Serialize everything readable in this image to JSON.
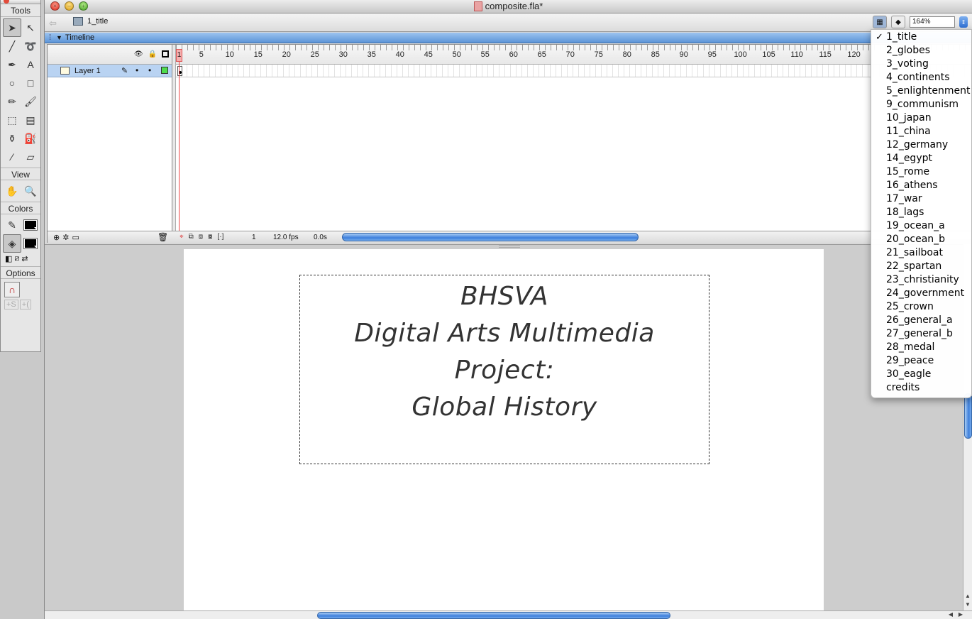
{
  "window": {
    "title": "composite.fla*"
  },
  "tools_panel": {
    "title": "Tools",
    "view_label": "View",
    "colors_label": "Colors",
    "options_label": "Options",
    "tools": [
      {
        "name": "selection-tool",
        "icon": "arrow-icon",
        "glyph": "➤"
      },
      {
        "name": "subselection-tool",
        "icon": "white-arrow-icon",
        "glyph": "↖"
      },
      {
        "name": "line-tool",
        "icon": "line-icon",
        "glyph": "╱"
      },
      {
        "name": "lasso-tool",
        "icon": "lasso-icon",
        "glyph": "➰"
      },
      {
        "name": "pen-tool",
        "icon": "pen-icon",
        "glyph": "✒"
      },
      {
        "name": "text-tool",
        "icon": "text-icon",
        "glyph": "A"
      },
      {
        "name": "oval-tool",
        "icon": "oval-icon",
        "glyph": "○"
      },
      {
        "name": "rectangle-tool",
        "icon": "rectangle-icon",
        "glyph": "□"
      },
      {
        "name": "pencil-tool",
        "icon": "pencil-icon",
        "glyph": "✏"
      },
      {
        "name": "brush-tool",
        "icon": "brush-icon",
        "glyph": "🖌"
      },
      {
        "name": "free-transform-tool",
        "icon": "free-transform-icon",
        "glyph": "⬚"
      },
      {
        "name": "gradient-transform-tool",
        "icon": "gradient-transform-icon",
        "glyph": "▤"
      },
      {
        "name": "ink-bottle-tool",
        "icon": "ink-bottle-icon",
        "glyph": "⚱"
      },
      {
        "name": "paint-bucket-tool",
        "icon": "paint-bucket-icon",
        "glyph": "⛽"
      },
      {
        "name": "eyedropper-tool",
        "icon": "eyedropper-icon",
        "glyph": "⁄"
      },
      {
        "name": "eraser-tool",
        "icon": "eraser-icon",
        "glyph": "▱"
      }
    ],
    "view_tools": [
      {
        "name": "hand-tool",
        "icon": "hand-icon",
        "glyph": "✋"
      },
      {
        "name": "zoom-tool",
        "icon": "zoom-icon",
        "glyph": "🔍"
      }
    ]
  },
  "edit_bar": {
    "scene_name": "1_title",
    "zoom": "164%"
  },
  "timeline": {
    "title": "Timeline",
    "layer_name": "Layer 1",
    "ruler_numbers": [
      "5",
      "10",
      "15",
      "20",
      "25",
      "30",
      "35",
      "40",
      "45",
      "50",
      "55",
      "60",
      "65",
      "70",
      "75",
      "80",
      "85",
      "90",
      "95",
      "100",
      "105",
      "110",
      "115",
      "120"
    ],
    "current_frame_label": "1",
    "footer": {
      "frame": "1",
      "fps": "12.0 fps",
      "time": "0.0s"
    }
  },
  "stage": {
    "lines": [
      "BHSVA",
      "Digital Arts Multimedia Project:",
      "Global History"
    ]
  },
  "scene_menu": {
    "selected": "1_title",
    "items": [
      "1_title",
      "2_globes",
      "3_voting",
      "4_continents",
      "5_enlightenment",
      "9_communism",
      "10_japan",
      "11_china",
      "12_germany",
      "14_egypt",
      "15_rome",
      "16_athens",
      "17_war",
      "18_lags",
      "19_ocean_a",
      "20_ocean_b",
      "21_sailboat",
      "22_spartan",
      "23_christianity",
      "24_government",
      "25_crown",
      "26_general_a",
      "27_general_b",
      "28_medal",
      "29_peace",
      "30_eagle",
      "credits"
    ]
  },
  "colors": {
    "timeline_header": "#5d95d8",
    "layer_selected": "#b9d3f2",
    "layer_color": "#4ddc4d",
    "playhead": "#e44444",
    "scroll_thumb": "#3d7fdc"
  }
}
